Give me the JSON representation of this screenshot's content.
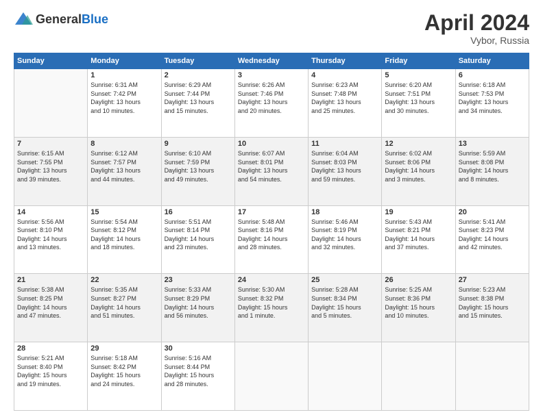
{
  "header": {
    "logo_general": "General",
    "logo_blue": "Blue",
    "month_title": "April 2024",
    "location": "Vybor, Russia"
  },
  "weekdays": [
    "Sunday",
    "Monday",
    "Tuesday",
    "Wednesday",
    "Thursday",
    "Friday",
    "Saturday"
  ],
  "weeks": [
    [
      {
        "day": "",
        "info": ""
      },
      {
        "day": "1",
        "info": "Sunrise: 6:31 AM\nSunset: 7:42 PM\nDaylight: 13 hours\nand 10 minutes."
      },
      {
        "day": "2",
        "info": "Sunrise: 6:29 AM\nSunset: 7:44 PM\nDaylight: 13 hours\nand 15 minutes."
      },
      {
        "day": "3",
        "info": "Sunrise: 6:26 AM\nSunset: 7:46 PM\nDaylight: 13 hours\nand 20 minutes."
      },
      {
        "day": "4",
        "info": "Sunrise: 6:23 AM\nSunset: 7:48 PM\nDaylight: 13 hours\nand 25 minutes."
      },
      {
        "day": "5",
        "info": "Sunrise: 6:20 AM\nSunset: 7:51 PM\nDaylight: 13 hours\nand 30 minutes."
      },
      {
        "day": "6",
        "info": "Sunrise: 6:18 AM\nSunset: 7:53 PM\nDaylight: 13 hours\nand 34 minutes."
      }
    ],
    [
      {
        "day": "7",
        "info": "Sunrise: 6:15 AM\nSunset: 7:55 PM\nDaylight: 13 hours\nand 39 minutes."
      },
      {
        "day": "8",
        "info": "Sunrise: 6:12 AM\nSunset: 7:57 PM\nDaylight: 13 hours\nand 44 minutes."
      },
      {
        "day": "9",
        "info": "Sunrise: 6:10 AM\nSunset: 7:59 PM\nDaylight: 13 hours\nand 49 minutes."
      },
      {
        "day": "10",
        "info": "Sunrise: 6:07 AM\nSunset: 8:01 PM\nDaylight: 13 hours\nand 54 minutes."
      },
      {
        "day": "11",
        "info": "Sunrise: 6:04 AM\nSunset: 8:03 PM\nDaylight: 13 hours\nand 59 minutes."
      },
      {
        "day": "12",
        "info": "Sunrise: 6:02 AM\nSunset: 8:06 PM\nDaylight: 14 hours\nand 3 minutes."
      },
      {
        "day": "13",
        "info": "Sunrise: 5:59 AM\nSunset: 8:08 PM\nDaylight: 14 hours\nand 8 minutes."
      }
    ],
    [
      {
        "day": "14",
        "info": "Sunrise: 5:56 AM\nSunset: 8:10 PM\nDaylight: 14 hours\nand 13 minutes."
      },
      {
        "day": "15",
        "info": "Sunrise: 5:54 AM\nSunset: 8:12 PM\nDaylight: 14 hours\nand 18 minutes."
      },
      {
        "day": "16",
        "info": "Sunrise: 5:51 AM\nSunset: 8:14 PM\nDaylight: 14 hours\nand 23 minutes."
      },
      {
        "day": "17",
        "info": "Sunrise: 5:48 AM\nSunset: 8:16 PM\nDaylight: 14 hours\nand 28 minutes."
      },
      {
        "day": "18",
        "info": "Sunrise: 5:46 AM\nSunset: 8:19 PM\nDaylight: 14 hours\nand 32 minutes."
      },
      {
        "day": "19",
        "info": "Sunrise: 5:43 AM\nSunset: 8:21 PM\nDaylight: 14 hours\nand 37 minutes."
      },
      {
        "day": "20",
        "info": "Sunrise: 5:41 AM\nSunset: 8:23 PM\nDaylight: 14 hours\nand 42 minutes."
      }
    ],
    [
      {
        "day": "21",
        "info": "Sunrise: 5:38 AM\nSunset: 8:25 PM\nDaylight: 14 hours\nand 47 minutes."
      },
      {
        "day": "22",
        "info": "Sunrise: 5:35 AM\nSunset: 8:27 PM\nDaylight: 14 hours\nand 51 minutes."
      },
      {
        "day": "23",
        "info": "Sunrise: 5:33 AM\nSunset: 8:29 PM\nDaylight: 14 hours\nand 56 minutes."
      },
      {
        "day": "24",
        "info": "Sunrise: 5:30 AM\nSunset: 8:32 PM\nDaylight: 15 hours\nand 1 minute."
      },
      {
        "day": "25",
        "info": "Sunrise: 5:28 AM\nSunset: 8:34 PM\nDaylight: 15 hours\nand 5 minutes."
      },
      {
        "day": "26",
        "info": "Sunrise: 5:25 AM\nSunset: 8:36 PM\nDaylight: 15 hours\nand 10 minutes."
      },
      {
        "day": "27",
        "info": "Sunrise: 5:23 AM\nSunset: 8:38 PM\nDaylight: 15 hours\nand 15 minutes."
      }
    ],
    [
      {
        "day": "28",
        "info": "Sunrise: 5:21 AM\nSunset: 8:40 PM\nDaylight: 15 hours\nand 19 minutes."
      },
      {
        "day": "29",
        "info": "Sunrise: 5:18 AM\nSunset: 8:42 PM\nDaylight: 15 hours\nand 24 minutes."
      },
      {
        "day": "30",
        "info": "Sunrise: 5:16 AM\nSunset: 8:44 PM\nDaylight: 15 hours\nand 28 minutes."
      },
      {
        "day": "",
        "info": ""
      },
      {
        "day": "",
        "info": ""
      },
      {
        "day": "",
        "info": ""
      },
      {
        "day": "",
        "info": ""
      }
    ]
  ]
}
